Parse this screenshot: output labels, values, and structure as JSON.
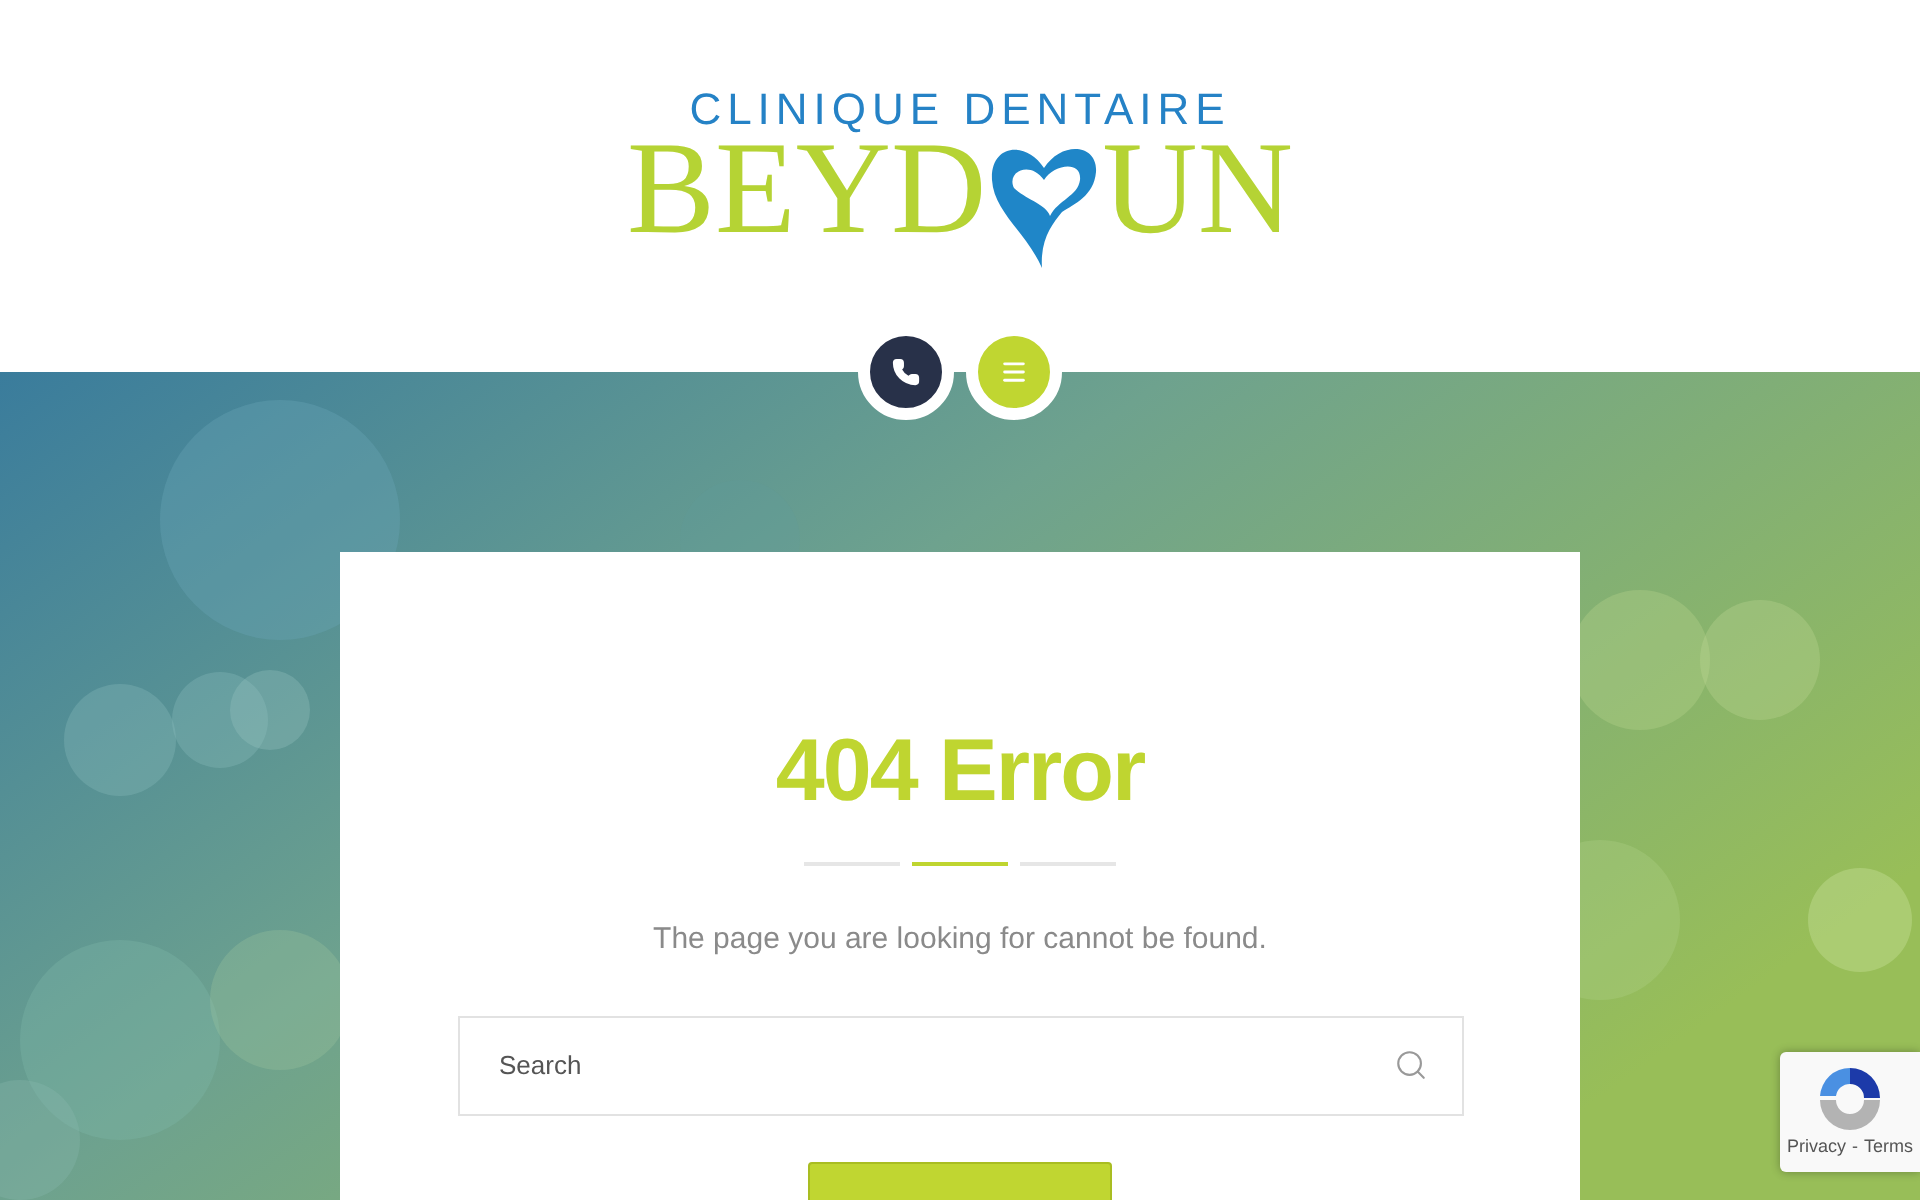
{
  "logo": {
    "tagline": "CLINIQUE DENTAIRE",
    "name_start": "BEYD",
    "name_end": "UN"
  },
  "header_buttons": [
    {
      "kind": "phone"
    },
    {
      "kind": "menu"
    }
  ],
  "error": {
    "title": "404 Error",
    "message": "The page you are looking for cannot be found.",
    "search": {
      "placeholder": "Search"
    }
  },
  "recaptcha": {
    "links": [
      "Privacy",
      "-",
      "Terms"
    ]
  }
}
